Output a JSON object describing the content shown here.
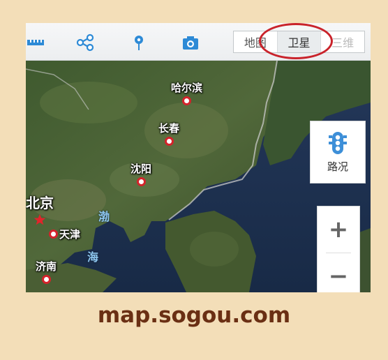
{
  "toolbar": {
    "icons": [
      "ruler-icon",
      "share-icon",
      "location-pin-icon",
      "camera-icon"
    ],
    "layers": [
      {
        "label": "地图",
        "active": false
      },
      {
        "label": "卫星",
        "active": true
      },
      {
        "label": "三维",
        "active": false
      }
    ],
    "accent": "#c9232b"
  },
  "map": {
    "cities": [
      {
        "name": "哈尔滨"
      },
      {
        "name": "长春"
      },
      {
        "name": "沈阳"
      },
      {
        "name": "北京",
        "capital": true
      },
      {
        "name": "天津"
      },
      {
        "name": "济南"
      }
    ],
    "seas": [
      "渤",
      "海"
    ]
  },
  "controls": {
    "traffic_label": "路况",
    "zoom_in": "+",
    "zoom_out": "−"
  },
  "caption": "map.sogou.com"
}
